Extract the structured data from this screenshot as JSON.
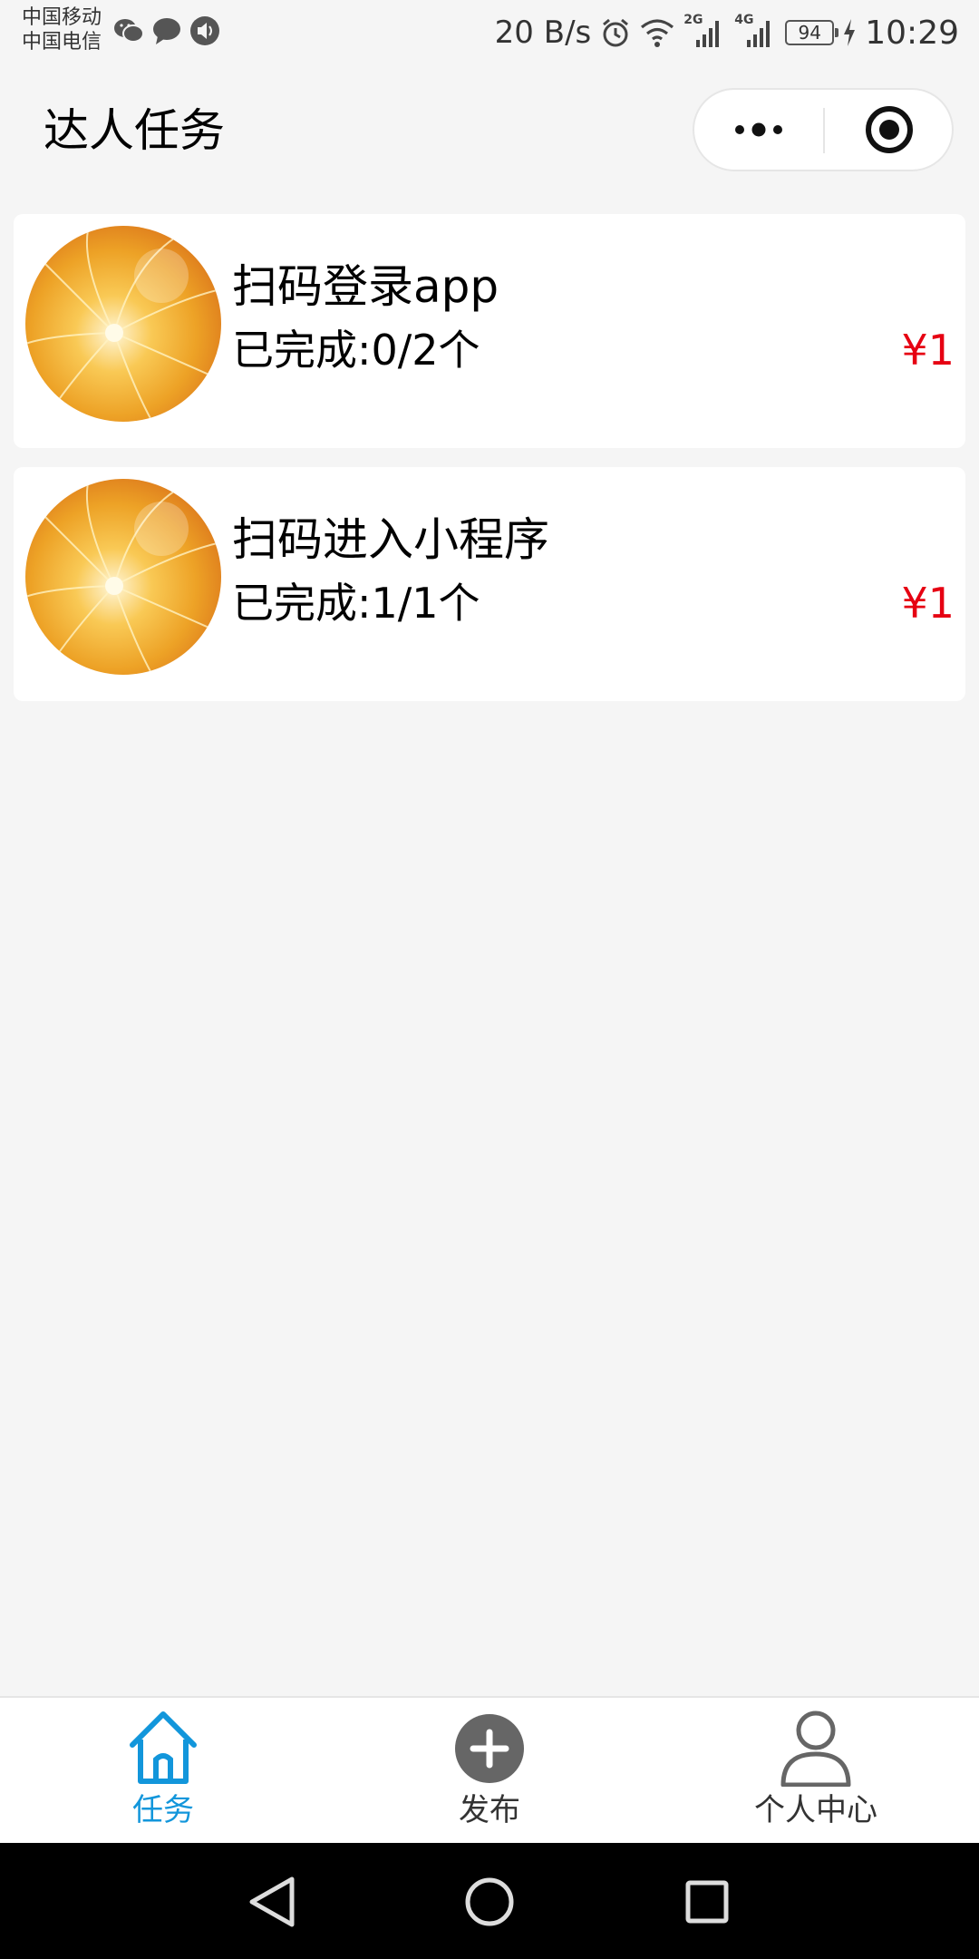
{
  "status_bar": {
    "carrier_1": "中国移动",
    "carrier_2": "中国电信",
    "net_speed": "20 B/s",
    "signal_1": "2G",
    "signal_2": "4G",
    "battery": "94",
    "time": "10:29"
  },
  "nav": {
    "title": "达人任务",
    "more_icon": "more-dots-icon",
    "close_icon": "target-circle-icon"
  },
  "tasks": [
    {
      "title": "扫码登录app",
      "progress": "已完成:0/2个",
      "price": "¥1",
      "avatar": "flower-petal-image"
    },
    {
      "title": "扫码进入小程序",
      "progress": "已完成:1/1个",
      "price": "¥1",
      "avatar": "flower-petal-image"
    }
  ],
  "tab_bar": {
    "active_color": "#1296db",
    "inactive_color": "#333333",
    "tabs": [
      {
        "label": "任务",
        "icon": "home-icon",
        "active": true
      },
      {
        "label": "发布",
        "icon": "plus-circle-icon",
        "active": false
      },
      {
        "label": "个人中心",
        "icon": "person-icon",
        "active": false
      }
    ]
  },
  "colors": {
    "price": "#e60012",
    "background": "#f5f5f5"
  }
}
